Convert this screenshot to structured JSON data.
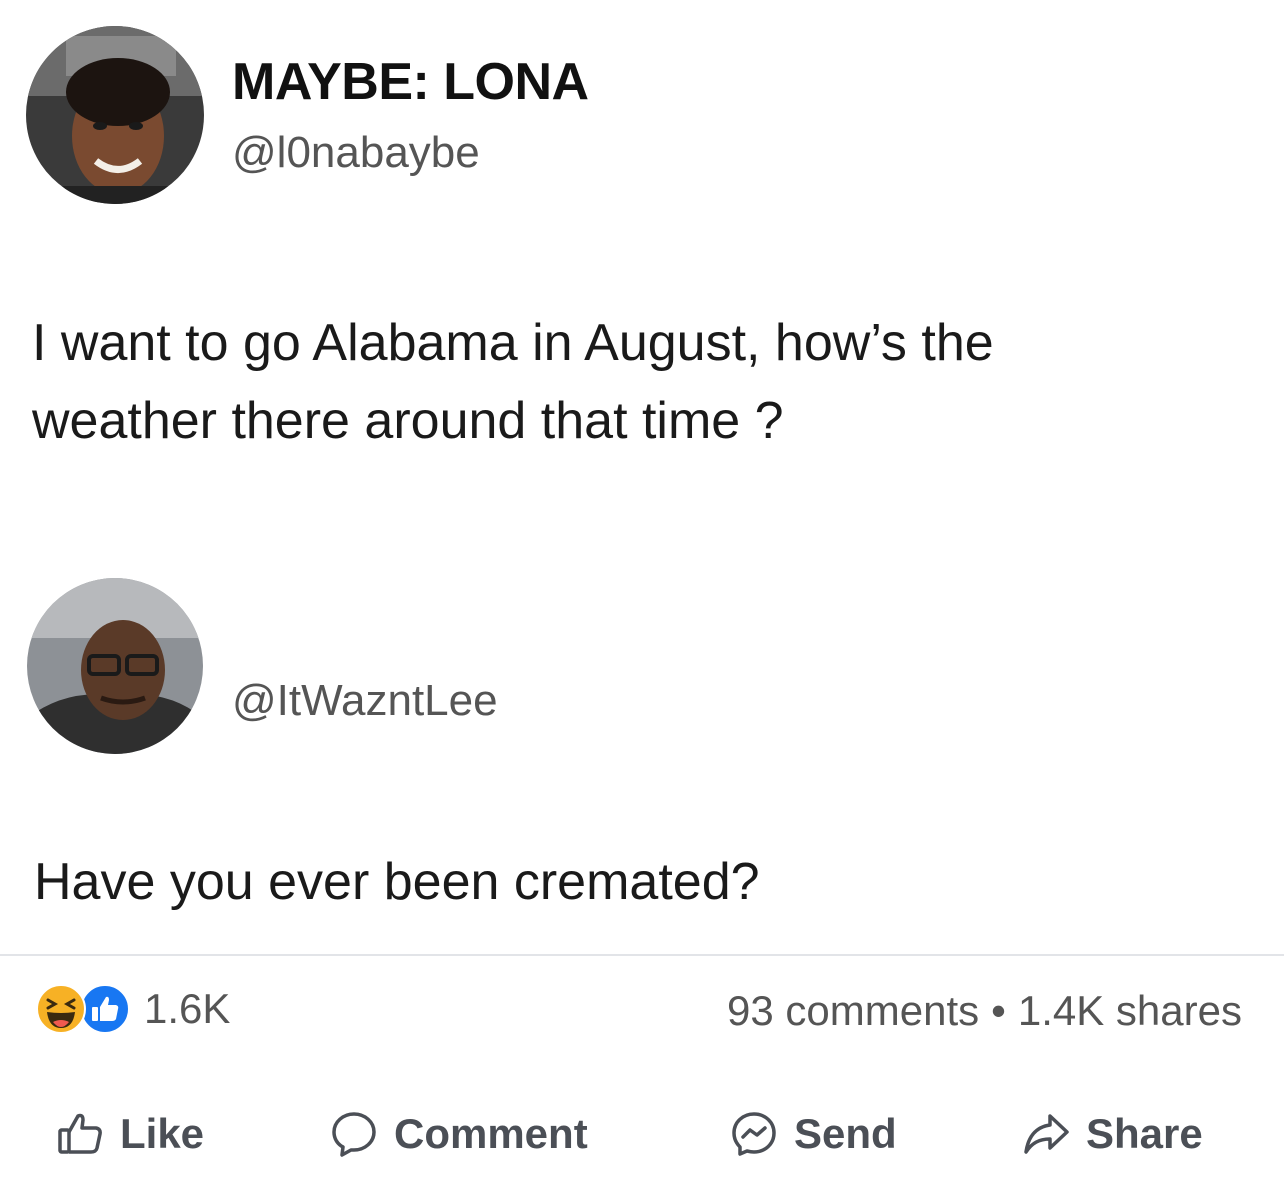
{
  "post": {
    "author": {
      "display_name": "MAYBE: LONA",
      "handle": "@l0nabaybe"
    },
    "text_lines": [
      "I want to go Alabama in August, how’s the",
      "weather there around that time ?"
    ],
    "reply": {
      "handle": "@ItWazntLee",
      "text": "Have you ever been cremated?"
    }
  },
  "engagement": {
    "reactions_count": "1.6K",
    "comments": "93 comments",
    "separator": "•",
    "shares": "1.4K shares",
    "reaction_icons": [
      "haha-icon",
      "like-icon"
    ]
  },
  "actions": {
    "like": "Like",
    "comment": "Comment",
    "send": "Send",
    "share": "Share"
  },
  "colors": {
    "like_blue": "#1877f2",
    "haha_yellow": "#f7b125",
    "muted_text": "#555555",
    "divider": "#e2e4e8"
  }
}
